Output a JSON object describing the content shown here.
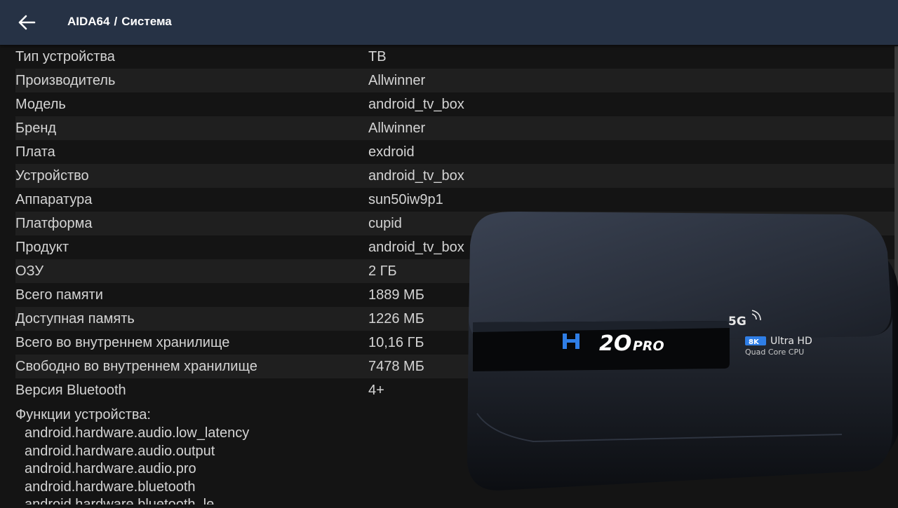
{
  "header": {
    "app": "AIDA64",
    "separator": "/",
    "page": "Система",
    "back_icon": "arrow-left-icon"
  },
  "rows": [
    {
      "key": "Тип устройства",
      "value": "ТВ"
    },
    {
      "key": "Производитель",
      "value": "Allwinner"
    },
    {
      "key": "Модель",
      "value": "android_tv_box"
    },
    {
      "key": "Бренд",
      "value": "Allwinner"
    },
    {
      "key": "Плата",
      "value": "exdroid"
    },
    {
      "key": "Устройство",
      "value": "android_tv_box"
    },
    {
      "key": "Аппаратура",
      "value": "sun50iw9p1"
    },
    {
      "key": "Платформа",
      "value": "cupid"
    },
    {
      "key": "Продукт",
      "value": "android_tv_box"
    },
    {
      "key": "ОЗУ",
      "value": "2 ГБ"
    },
    {
      "key": "Всего памяти",
      "value": "1889 МБ"
    },
    {
      "key": "Доступная память",
      "value": "1226 МБ"
    },
    {
      "key": "Всего во внутреннем хранилище",
      "value": "10,16 ГБ"
    },
    {
      "key": "Свободно во внутреннем хранилище",
      "value": "7478 МБ"
    },
    {
      "key": "Версия Bluetooth",
      "value": "4+"
    }
  ],
  "features": {
    "heading": "Функции устройства:",
    "items": [
      "android.hardware.audio.low_latency",
      "android.hardware.audio.output",
      "android.hardware.audio.pro",
      "android.hardware.bluetooth",
      "android.hardware.bluetooth_le"
    ]
  },
  "product_image": {
    "brand_logo": "H 20 PRO",
    "badge_5g": "5G",
    "badge_8k": "8K",
    "ultra_hd": "Ultra HD",
    "cpu": "Quad Core CPU"
  },
  "colors": {
    "header_bg": "#263245",
    "body_bg": "#141414",
    "row_alt_bg": "#1f1f1f",
    "logo_blue": "#2f7ee6"
  }
}
